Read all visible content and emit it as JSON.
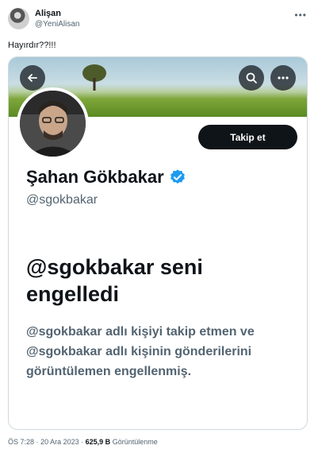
{
  "tweet": {
    "display_name": "Alişan",
    "handle": "@YeniAlisan",
    "text": "Hayırdır??!!!",
    "time": "ÖS 7:28",
    "separator": "·",
    "date": "20 Ara 2023",
    "views_count": "625,9 B",
    "views_label": "Görüntülenme"
  },
  "profile": {
    "name": "Şahan Gökbakar",
    "handle": "@sgokbakar",
    "follow_label": "Takip et",
    "blocked_title": "@sgokbakar seni engelledi",
    "blocked_description": "@sgokbakar adlı kişiyi takip etmen ve @sgokbakar adlı kişinin gönderilerini görüntülemen engellenmiş."
  },
  "icons": {
    "more": "more-horizontal-icon",
    "back": "arrow-left-icon",
    "search": "search-icon",
    "profile_more": "more-horizontal-icon",
    "verified": "verified-badge-icon"
  },
  "colors": {
    "verified": "#1d9bf0",
    "follow_button": "#0f1419",
    "secondary_text": "#536471"
  }
}
